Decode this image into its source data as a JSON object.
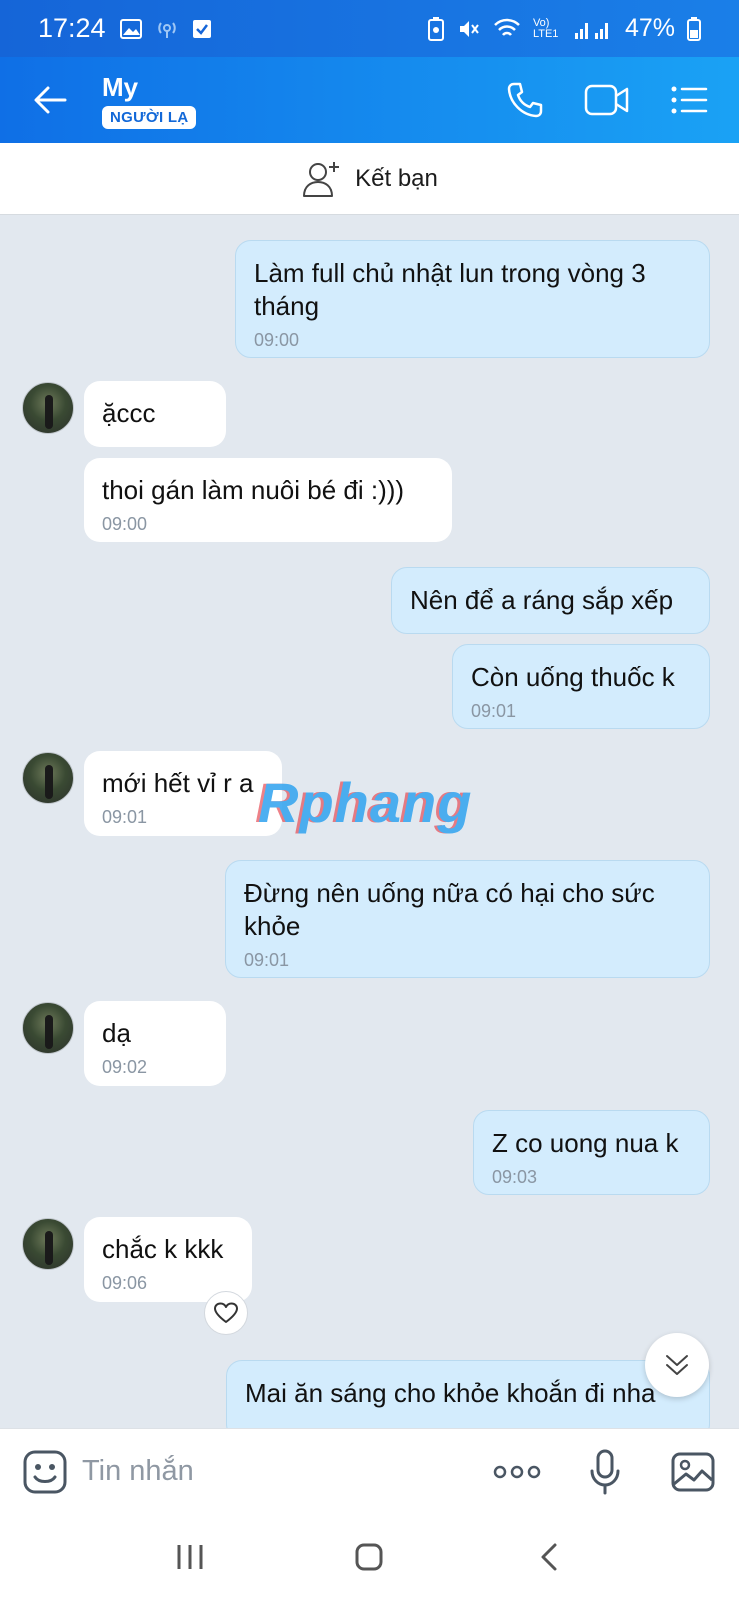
{
  "status_bar": {
    "time": "17:24",
    "battery": "47%",
    "network_label": "Vo) LTE1"
  },
  "header": {
    "contact_name": "My",
    "badge": "NGƯỜI LẠ"
  },
  "add_friend": {
    "label": "Kết bạn"
  },
  "messages": [
    {
      "side": "out",
      "text": "Làm full chủ nhật lun trong vòng 3 tháng",
      "time": "09:00"
    },
    {
      "side": "in",
      "text": "ặccc",
      "time": ""
    },
    {
      "side": "in",
      "text": "thoi gán làm nuôi bé đi :)))",
      "time": "09:00"
    },
    {
      "side": "out",
      "text": "Nên để a ráng sắp xếp",
      "time": ""
    },
    {
      "side": "out",
      "text": "Còn uống thuốc k",
      "time": "09:01"
    },
    {
      "side": "in",
      "text": "mới hết vỉ r a",
      "time": "09:01"
    },
    {
      "side": "out",
      "text": "Đừng nên uống nữa có hại cho sức khỏe",
      "time": "09:01"
    },
    {
      "side": "in",
      "text": "dạ",
      "time": "09:02"
    },
    {
      "side": "out",
      "text": "Z co uong nua k",
      "time": "09:03"
    },
    {
      "side": "in",
      "text": "chắc k kkk",
      "time": "09:06"
    },
    {
      "side": "out",
      "text": "Mai ăn sáng cho khỏe khoắn đi nha",
      "time": ""
    }
  ],
  "watermark": "Rphang",
  "input": {
    "placeholder": "Tin nhắn"
  },
  "colors": {
    "header": "#1a8cf0",
    "outgoing_bubble": "#d3ecfd",
    "incoming_bubble": "#ffffff",
    "chat_bg": "#e2e8ef"
  }
}
